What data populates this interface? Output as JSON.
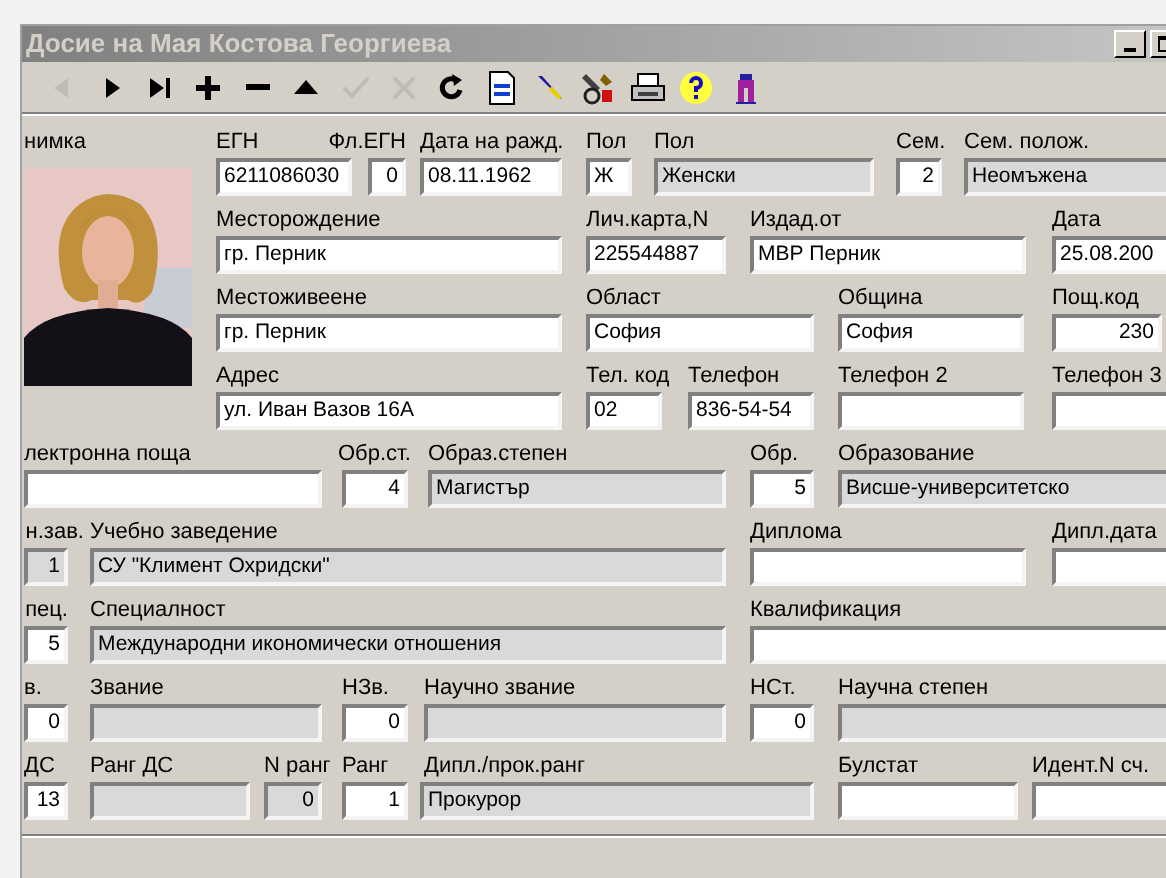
{
  "window": {
    "title": "Досие на Мая Костова Георгиева"
  },
  "toolbar": [
    {
      "kind": "prior",
      "disabled": true
    },
    {
      "kind": "next",
      "disabled": false
    },
    {
      "kind": "last",
      "disabled": false
    },
    {
      "kind": "insert",
      "disabled": false
    },
    {
      "kind": "delete",
      "disabled": false
    },
    {
      "kind": "edit",
      "disabled": false
    },
    {
      "kind": "post",
      "disabled": true
    },
    {
      "kind": "cancel",
      "disabled": true
    },
    {
      "kind": "refresh",
      "disabled": false
    },
    {
      "kind": "document",
      "disabled": false
    },
    {
      "kind": "pen",
      "disabled": false
    },
    {
      "kind": "tools",
      "disabled": false
    },
    {
      "kind": "printer",
      "disabled": false
    },
    {
      "kind": "help",
      "disabled": false
    },
    {
      "kind": "figure",
      "disabled": false
    }
  ],
  "photo_label": "нимка",
  "rows": [
    {
      "fields": [
        {
          "label": "ЕГН",
          "value": "6211086030",
          "kind": "text",
          "readonly": false
        },
        {
          "label": "Фл.ЕГН",
          "value": "0",
          "kind": "number",
          "readonly": false
        },
        {
          "label": "Дата на ражд.",
          "value": "08.11.1962",
          "kind": "text",
          "readonly": false
        },
        {
          "label": "Пол",
          "value": "Ж",
          "kind": "text",
          "readonly": false
        },
        {
          "label": "Пол",
          "value": "Женски",
          "kind": "text",
          "readonly": true
        },
        {
          "label": "Сем.",
          "value": "2",
          "kind": "number",
          "readonly": false
        },
        {
          "label": "Сем. полож.",
          "value": "Неомъжена",
          "kind": "text",
          "readonly": true
        }
      ]
    },
    {
      "fields": [
        {
          "label": "Месторождение",
          "value": "гр. Перник",
          "kind": "text",
          "readonly": false
        },
        {
          "label": "Лич.карта,N",
          "value": "225544887",
          "kind": "text",
          "readonly": false
        },
        {
          "label": "Издад.от",
          "value": "МВР Перник",
          "kind": "text",
          "readonly": false
        },
        {
          "label": "Дата",
          "value": "25.08.200",
          "kind": "text",
          "readonly": false
        }
      ]
    },
    {
      "fields": [
        {
          "label": "Местоживеене",
          "value": "гр. Перник",
          "kind": "text",
          "readonly": false
        },
        {
          "label": "Област",
          "value": "София",
          "kind": "text",
          "readonly": false
        },
        {
          "label": "Община",
          "value": "София",
          "kind": "text",
          "readonly": false
        },
        {
          "label": "Пощ.код",
          "value": "230",
          "kind": "number",
          "readonly": false
        }
      ]
    },
    {
      "fields": [
        {
          "label": "Адрес",
          "value": "ул. Иван Вазов 16А",
          "kind": "text",
          "readonly": false
        },
        {
          "label": "Тел. код",
          "value": "02",
          "kind": "text",
          "readonly": false
        },
        {
          "label": "Телефон",
          "value": "836-54-54",
          "kind": "text",
          "readonly": false
        },
        {
          "label": "Телефон 2",
          "kind": "text",
          "readonly": false
        },
        {
          "label": "Телефон 3",
          "kind": "text",
          "readonly": false
        }
      ]
    },
    {
      "fields": [
        {
          "label": "лектронна поща",
          "kind": "text",
          "readonly": false
        },
        {
          "label": "Обр.ст.",
          "value": "4",
          "kind": "number",
          "readonly": false
        },
        {
          "label": "Образ.степен",
          "value": "Магистър",
          "kind": "text",
          "readonly": true
        },
        {
          "label": "Обр.",
          "value": "5",
          "kind": "number",
          "readonly": false
        },
        {
          "label": "Образование",
          "value": "Висше-университетско",
          "kind": "text",
          "readonly": true
        }
      ]
    },
    {
      "fields": [
        {
          "label": "н.зав.",
          "value": "1",
          "kind": "number",
          "readonly": true
        },
        {
          "label": "Учебно заведение",
          "value": "СУ \"Климент Охридски\"",
          "kind": "text",
          "readonly": true
        },
        {
          "label": "Диплома",
          "kind": "text",
          "readonly": false
        },
        {
          "label": "Дипл.дата",
          "kind": "text",
          "readonly": false
        }
      ]
    },
    {
      "fields": [
        {
          "label": "пец.",
          "value": "5",
          "kind": "number",
          "readonly": false
        },
        {
          "label": "Специалност",
          "value": "Международни икономически отношения",
          "kind": "text",
          "readonly": true
        },
        {
          "label": "Квалификация",
          "kind": "text",
          "readonly": false
        }
      ]
    },
    {
      "fields": [
        {
          "label": "в.",
          "value": "0",
          "kind": "number",
          "readonly": false
        },
        {
          "label": "Звание",
          "kind": "text",
          "readonly": true
        },
        {
          "label": "НЗв.",
          "value": "0",
          "kind": "number",
          "readonly": false
        },
        {
          "label": "Научно звание",
          "kind": "text",
          "readonly": true
        },
        {
          "label": "НСт.",
          "value": "0",
          "kind": "number",
          "readonly": false
        },
        {
          "label": "Научна степен",
          "kind": "text",
          "readonly": true
        }
      ]
    },
    {
      "fields": [
        {
          "label": "ДС",
          "value": "13",
          "kind": "number",
          "readonly": false
        },
        {
          "label": "Ранг ДС",
          "kind": "text",
          "readonly": true
        },
        {
          "label": "N ранг",
          "value": "0",
          "kind": "number",
          "readonly": true
        },
        {
          "label": "Ранг",
          "value": "1",
          "kind": "number",
          "readonly": false
        },
        {
          "label": "Дипл./прок.ранг",
          "value": "Прокурор",
          "kind": "text",
          "readonly": true
        },
        {
          "label": "Булстат",
          "kind": "text",
          "readonly": false
        },
        {
          "label": "Идент.N сч.",
          "kind": "text",
          "readonly": false
        }
      ]
    }
  ]
}
